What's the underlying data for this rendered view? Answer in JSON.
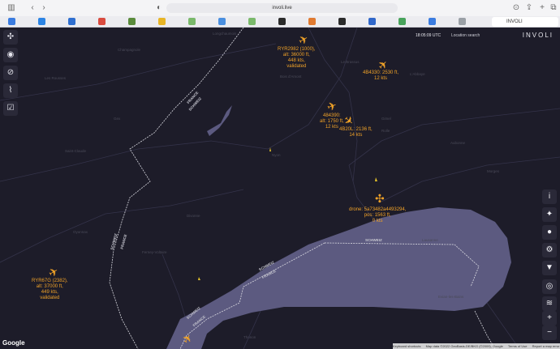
{
  "browser": {
    "url": "involi.live",
    "active_tab_title": "INVOLI",
    "tab_colors": [
      "#3b7ce0",
      "#2c84e4",
      "#2f6fd0",
      "#d94b3f",
      "#5a8b3c",
      "#e8b526",
      "#7ab96b",
      "#4a8fe0",
      "#7ab96b",
      "#2b2b2b",
      "#e07a30",
      "#2b2b2b",
      "#3067c9",
      "#48a35b",
      "#3b7ce0",
      "#9aa0a6"
    ]
  },
  "header": {
    "brand": "INVOLI",
    "utc_time": "18:05:09 UTC",
    "location_search": "Location search"
  },
  "left_toolbar": [
    {
      "name": "drone-icon",
      "glyph": "✣"
    },
    {
      "name": "eye-icon",
      "glyph": "◉"
    },
    {
      "name": "compass-icon",
      "glyph": "⊘"
    },
    {
      "name": "trend-icon",
      "glyph": "⌇"
    },
    {
      "name": "checklist-icon",
      "glyph": "☑"
    }
  ],
  "right_toolbar": [
    {
      "name": "info-icon",
      "glyph": "i"
    },
    {
      "name": "marker-plus-icon",
      "glyph": "✦"
    },
    {
      "name": "user-icon",
      "glyph": "●"
    },
    {
      "name": "settings-icon",
      "glyph": "⚙"
    },
    {
      "name": "filter-icon",
      "glyph": "▼"
    },
    {
      "name": "locate-icon",
      "glyph": "◎"
    },
    {
      "name": "layers-icon",
      "glyph": "≋"
    },
    {
      "name": "zoom-in-icon",
      "glyph": "+"
    },
    {
      "name": "zoom-out-icon",
      "glyph": "−"
    }
  ],
  "aircraft": [
    {
      "lines": [
        "RYR2982 (1000),",
        "alt: 36000 ft,",
        "448 kts,",
        "validated"
      ]
    },
    {
      "lines": [
        "4B4330: 2530 ft,",
        "12 kts"
      ]
    },
    {
      "lines": [
        "484390:",
        "alt: 1750 ft,",
        "12 kts"
      ]
    },
    {
      "lines": [
        "4B20L: 2136 ft,",
        "14 kts"
      ]
    },
    {
      "lines": [
        "drone: 5a73482a4493294,",
        "pos: 1563 ft,",
        "0 kts"
      ]
    },
    {
      "lines": [
        "RYR67G (2382),",
        "alt: 37000 ft,",
        "449 kts,",
        "validated"
      ]
    }
  ],
  "border_labels": [
    "FRANCE",
    "SCHWEIZ",
    "SCHWEIZ",
    "FRANCE",
    "SCHWEIZ",
    "FRANCE",
    "SCHWEIZ",
    "SCHWEIZ",
    "FRANCE"
  ],
  "map_footer": {
    "google": "Google",
    "links": [
      "Keyboard shortcuts",
      "Map data ©2022 GeoBasis-DE/BKG (©2009), Google",
      "Terms of Use",
      "Report a map error"
    ]
  },
  "colors": {
    "accent": "#f0a228",
    "map_bg": "#1d1c29",
    "lake": "#5c5a80",
    "border": "#d9d9e0"
  }
}
